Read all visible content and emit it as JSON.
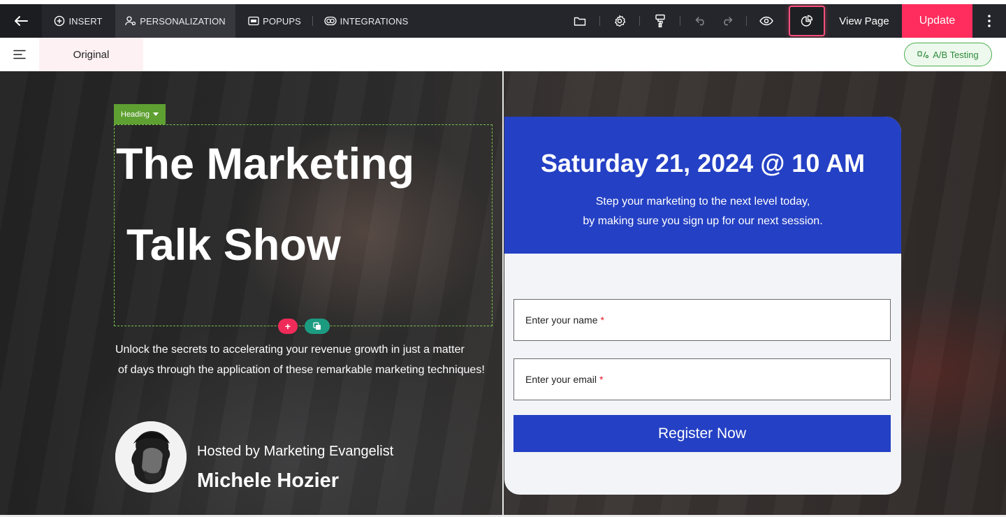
{
  "toolbar": {
    "menus": {
      "insert": "INSERT",
      "personalization": "PERSONALIZATION",
      "popups": "POPUPS",
      "integrations": "INTEGRATIONS"
    },
    "view_page": "View Page",
    "update": "Update",
    "icons": [
      "back-arrow-icon",
      "plus-circle-icon",
      "personalization-icon",
      "popups-icon",
      "integrations-icon",
      "folder-icon",
      "gear-icon",
      "paint-roller-icon",
      "undo-icon",
      "redo-icon",
      "eye-icon",
      "analytics-icon",
      "more-vertical-icon"
    ]
  },
  "subbar": {
    "variant_tab": "Original",
    "ab_testing": "A/B Testing"
  },
  "editor": {
    "selected_element_label": "Heading"
  },
  "hero": {
    "title_line1": "The Marketing",
    "title_line2": "Talk Show",
    "subtitle_line1": "Unlock the secrets to accelerating your revenue growth in just a matter",
    "subtitle_line2": "of days through the application of these remarkable marketing techniques!",
    "host_label": "Hosted by Marketing Evangelist",
    "host_name": "Michele Hozier"
  },
  "card": {
    "date": "Saturday 21, 2024 @ 10 AM",
    "desc_line1": "Step your marketing to the next level today,",
    "desc_line2": "by making sure you sign up for our next session.",
    "name_placeholder": "Enter your name",
    "email_placeholder": "Enter your email",
    "required_mark": "*",
    "register": "Register Now"
  },
  "colors": {
    "update_button": "#fe2d5d",
    "card_blue": "#2440c4",
    "heading_tag_green": "#5fa032",
    "ab_testing_green": "#4caf50"
  }
}
